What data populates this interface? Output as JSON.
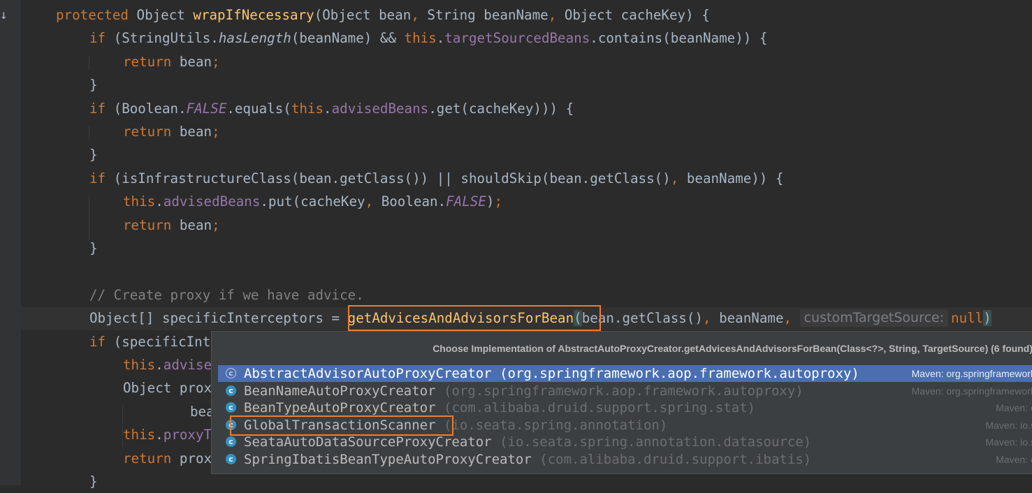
{
  "editor": {
    "gutter_mark": "↓",
    "lines": [
      {
        "indent": 0,
        "tokens": [
          {
            "t": "protected ",
            "c": "kw"
          },
          {
            "t": "Object "
          },
          {
            "t": "wrapIfNecessary",
            "c": "fn"
          },
          {
            "t": "(Object bean"
          },
          {
            "t": ", ",
            "c": "kw"
          },
          {
            "t": "String beanName"
          },
          {
            "t": ", ",
            "c": "kw"
          },
          {
            "t": "Object cacheKey) {"
          }
        ]
      },
      {
        "indent": 1,
        "tokens": [
          {
            "t": "if ",
            "c": "kw"
          },
          {
            "t": "(StringUtils."
          },
          {
            "t": "hasLength",
            "c": "it"
          },
          {
            "t": "(beanName) && "
          },
          {
            "t": "this",
            "c": "kw"
          },
          {
            "t": "."
          },
          {
            "t": "targetSourcedBeans",
            "c": "fld"
          },
          {
            "t": ".contains(beanName)) {"
          }
        ]
      },
      {
        "indent": 2,
        "tokens": [
          {
            "t": "return ",
            "c": "kw"
          },
          {
            "t": "bean"
          },
          {
            "t": ";",
            "c": "kw"
          }
        ]
      },
      {
        "indent": 1,
        "tokens": [
          {
            "t": "}"
          }
        ]
      },
      {
        "indent": 1,
        "tokens": [
          {
            "t": "if ",
            "c": "kw"
          },
          {
            "t": "(Boolean."
          },
          {
            "t": "FALSE",
            "c": "fld it"
          },
          {
            "t": ".equals("
          },
          {
            "t": "this",
            "c": "kw"
          },
          {
            "t": "."
          },
          {
            "t": "advisedBeans",
            "c": "fld"
          },
          {
            "t": ".get(cacheKey))) {"
          }
        ]
      },
      {
        "indent": 2,
        "tokens": [
          {
            "t": "return ",
            "c": "kw"
          },
          {
            "t": "bean"
          },
          {
            "t": ";",
            "c": "kw"
          }
        ]
      },
      {
        "indent": 1,
        "tokens": [
          {
            "t": "}"
          }
        ]
      },
      {
        "indent": 1,
        "tokens": [
          {
            "t": "if ",
            "c": "kw"
          },
          {
            "t": "(isInfrastructureClass(bean.getClass()) || shouldSkip(bean.getClass()"
          },
          {
            "t": ", ",
            "c": "kw"
          },
          {
            "t": "beanName)) {"
          }
        ]
      },
      {
        "indent": 2,
        "tokens": [
          {
            "t": "this",
            "c": "kw"
          },
          {
            "t": "."
          },
          {
            "t": "advisedBeans",
            "c": "fld"
          },
          {
            "t": ".put(cacheKey"
          },
          {
            "t": ", ",
            "c": "kw"
          },
          {
            "t": "Boolean."
          },
          {
            "t": "FALSE",
            "c": "fld it"
          },
          {
            "t": ")"
          },
          {
            "t": ";",
            "c": "kw"
          }
        ]
      },
      {
        "indent": 2,
        "tokens": [
          {
            "t": "return ",
            "c": "kw"
          },
          {
            "t": "bean"
          },
          {
            "t": ";",
            "c": "kw"
          }
        ]
      },
      {
        "indent": 1,
        "tokens": [
          {
            "t": "}"
          }
        ]
      },
      {
        "indent": 0,
        "tokens": []
      },
      {
        "indent": 1,
        "tokens": [
          {
            "t": "// Create proxy if we have advice.",
            "c": "cm"
          }
        ]
      },
      {
        "indent": 1,
        "tokens": [
          {
            "t": "Object[] specificInterceptors = "
          },
          {
            "t": "getAdvicesAndAdvisorsForBean",
            "c": "fn"
          },
          {
            "t": "(",
            "c": "bm"
          },
          {
            "t": "bean.getClass()"
          },
          {
            "t": ", ",
            "c": "kw"
          },
          {
            "t": "beanName"
          },
          {
            "t": ", ",
            "c": "kw"
          },
          {
            "t": "customTargetSource:",
            "c": "hint"
          },
          {
            "t": "null",
            "c": "kw"
          },
          {
            "t": ")",
            "c": "bm"
          }
        ]
      },
      {
        "indent": 1,
        "tokens": [
          {
            "t": "if ",
            "c": "kw"
          },
          {
            "t": "(specificInt"
          }
        ]
      },
      {
        "indent": 2,
        "tokens": [
          {
            "t": "this",
            "c": "kw"
          },
          {
            "t": "."
          },
          {
            "t": "advise",
            "c": "fld"
          }
        ]
      },
      {
        "indent": 2,
        "tokens": [
          {
            "t": "Object prox"
          }
        ]
      },
      {
        "indent": 4,
        "tokens": [
          {
            "t": "bea"
          }
        ]
      },
      {
        "indent": 2,
        "tokens": [
          {
            "t": "this",
            "c": "kw"
          },
          {
            "t": "."
          },
          {
            "t": "proxyT",
            "c": "fld"
          }
        ]
      },
      {
        "indent": 2,
        "tokens": [
          {
            "t": "return ",
            "c": "kw"
          },
          {
            "t": "prox"
          }
        ]
      },
      {
        "indent": 1,
        "tokens": [
          {
            "t": "}"
          }
        ]
      }
    ]
  },
  "popup": {
    "title": "Choose Implementation of AbstractAutoProxyCreator.getAdvicesAndAdvisorsForBean(Class<?>, String, TargetSource) (6 found)",
    "items": [
      {
        "name": "AbstractAdvisorAutoProxyCreator",
        "package": "(org.springframework.aop.framework.autoproxy)",
        "source": "Maven: org.springframework",
        "icon": "abstract-class-icon",
        "selected": true
      },
      {
        "name": "BeanNameAutoProxyCreator",
        "package": "(org.springframework.aop.framework.autoproxy)",
        "source": "Maven: org.springframework",
        "icon": "class-icon",
        "selected": false
      },
      {
        "name": "BeanTypeAutoProxyCreator",
        "package": "(com.alibaba.druid.support.spring.stat)",
        "source": "Maven: c",
        "icon": "class-icon",
        "selected": false
      },
      {
        "name": "GlobalTransactionScanner",
        "package": "(io.seata.spring.annotation)",
        "source": "Maven: io.s",
        "icon": "class-icon",
        "selected": false
      },
      {
        "name": "SeataAutoDataSourceProxyCreator",
        "package": "(io.seata.spring.annotation.datasource)",
        "source": "Maven: io.s",
        "icon": "class-icon",
        "selected": false
      },
      {
        "name": "SpringIbatisBeanTypeAutoProxyCreator",
        "package": "(com.alibaba.druid.support.ibatis)",
        "source": "Maven: c",
        "icon": "class-icon",
        "selected": false
      }
    ],
    "icon_glyph": "c"
  },
  "colors": {
    "keyword": "#cc7832",
    "method": "#ffc66d",
    "field": "#9876aa",
    "comment": "#808080",
    "text": "#a9b7c6",
    "highlight_box": "#ef7d31",
    "selection": "#4b6eaf"
  }
}
